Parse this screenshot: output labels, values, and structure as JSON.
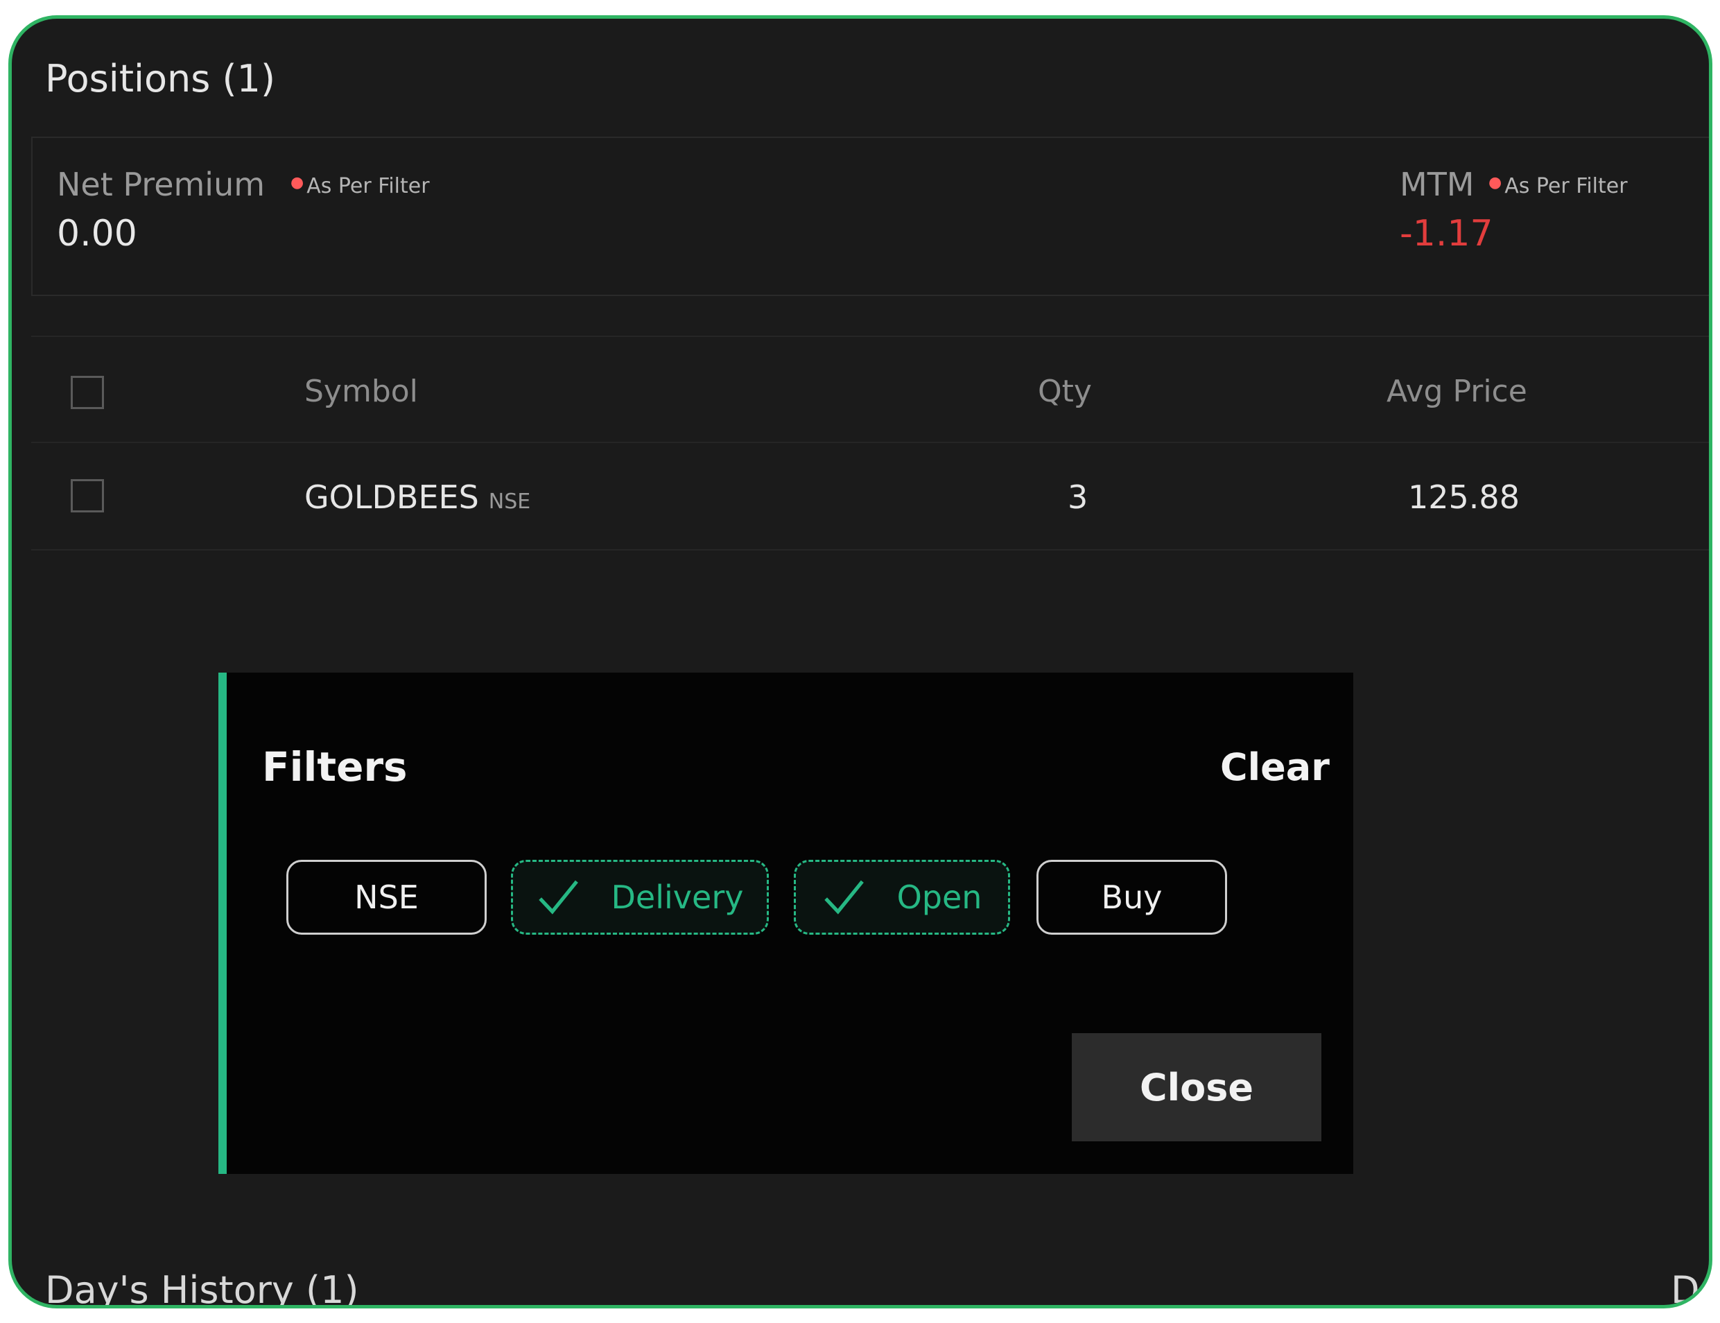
{
  "positions": {
    "title": "Positions (1)"
  },
  "summary": {
    "net_premium": {
      "label": "Net Premium",
      "note": "As Per Filter",
      "value": "0.00"
    },
    "mtm": {
      "label": "MTM",
      "note": "As Per Filter",
      "value": "-1.17",
      "value_color": "#e23d3d"
    }
  },
  "table": {
    "headers": {
      "symbol": "Symbol",
      "qty": "Qty",
      "avg_price": "Avg Price"
    },
    "rows": [
      {
        "symbol": "GOLDBEES",
        "exchange": "NSE",
        "qty": "3",
        "avg_price": "125.88"
      }
    ]
  },
  "filters": {
    "title": "Filters",
    "clear_label": "Clear",
    "chips": [
      {
        "label": "NSE",
        "selected": false
      },
      {
        "label": "Delivery",
        "selected": true,
        "icon": "check-icon"
      },
      {
        "label": "Open",
        "selected": true,
        "icon": "check-icon"
      },
      {
        "label": "Buy",
        "selected": false
      }
    ],
    "close_label": "Close",
    "accent_color": "#26b884"
  },
  "history": {
    "title": "Day's History (1)",
    "right_partial": "D"
  },
  "colors": {
    "frame_border": "#2fb463",
    "background": "#1b1b1b",
    "negative": "#e23d3d"
  }
}
